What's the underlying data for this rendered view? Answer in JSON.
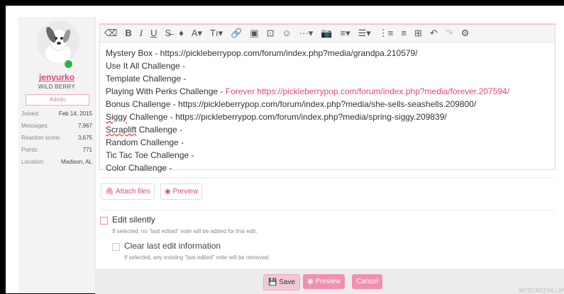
{
  "user": {
    "name": "jenyurko",
    "title": "WiLD BERRY",
    "banner": "Admin",
    "stats": [
      {
        "label": "Joined:",
        "value": "Feb 14, 2015"
      },
      {
        "label": "Messages:",
        "value": "7,967"
      },
      {
        "label": "Reaction score:",
        "value": "3,675"
      },
      {
        "label": "Points:",
        "value": "771"
      },
      {
        "label": "Location:",
        "value": "Madison, AL"
      }
    ]
  },
  "toolbar": {
    "eraser": "⌫",
    "bold": "B",
    "italic": "I",
    "underline": "U",
    "strike": "S̶",
    "color": "♦",
    "font": "A▾",
    "size": "Tı▾",
    "link": "🔗",
    "image": "▣",
    "media": "⊡",
    "emoji": "☺",
    "more": "···▾",
    "camera": "📷",
    "align": "≡▾",
    "list": "☰▾",
    "olist": "⋮≡",
    "ulist": "≡",
    "table": "⊞",
    "undo": "↶",
    "redo": "↷",
    "settings": "⚙"
  },
  "content": {
    "line1": "Mystery Box - https://pickleberrypop.com/forum/index.php?media/grandpa.210579/",
    "line2": "Use It All Challenge -",
    "line3": "Template Challenge -",
    "line4_prefix": "Playing With Perks Challenge -",
    "line4_link": "Forever https://pickleberrypop.com/forum/index.php?media/forever.207594/",
    "line5": "Bonus Challenge - https://pickleberrypop.com/forum/index.php?media/she-sells-seashells.209800/",
    "line6_word": "Siggy",
    "line6_rest": "Challenge - https://pickleberrypop.com/forum/index.php?media/spring-siggy.209839/",
    "line7_word": "Scraplift",
    "line7_rest": "Challenge -",
    "line8": "Random Challenge -",
    "line9": "Tic Tac Toe Challenge -",
    "line10": "Color Challenge -"
  },
  "attach": {
    "attach_label": "Attach files",
    "preview_label": "Preview"
  },
  "options": {
    "edit_silently": "Edit silently",
    "edit_silently_hint": "If selected, no \"last edited\" note will be added for this edit.",
    "clear_last_edit": "Clear last edit information",
    "clear_last_edit_hint": "If selected, any existing \"last edited\" note will be removed."
  },
  "footer": {
    "save": "Save",
    "preview": "Preview",
    "cancel": "Cancel"
  },
  "watermark": "MYSCREENCLIP"
}
